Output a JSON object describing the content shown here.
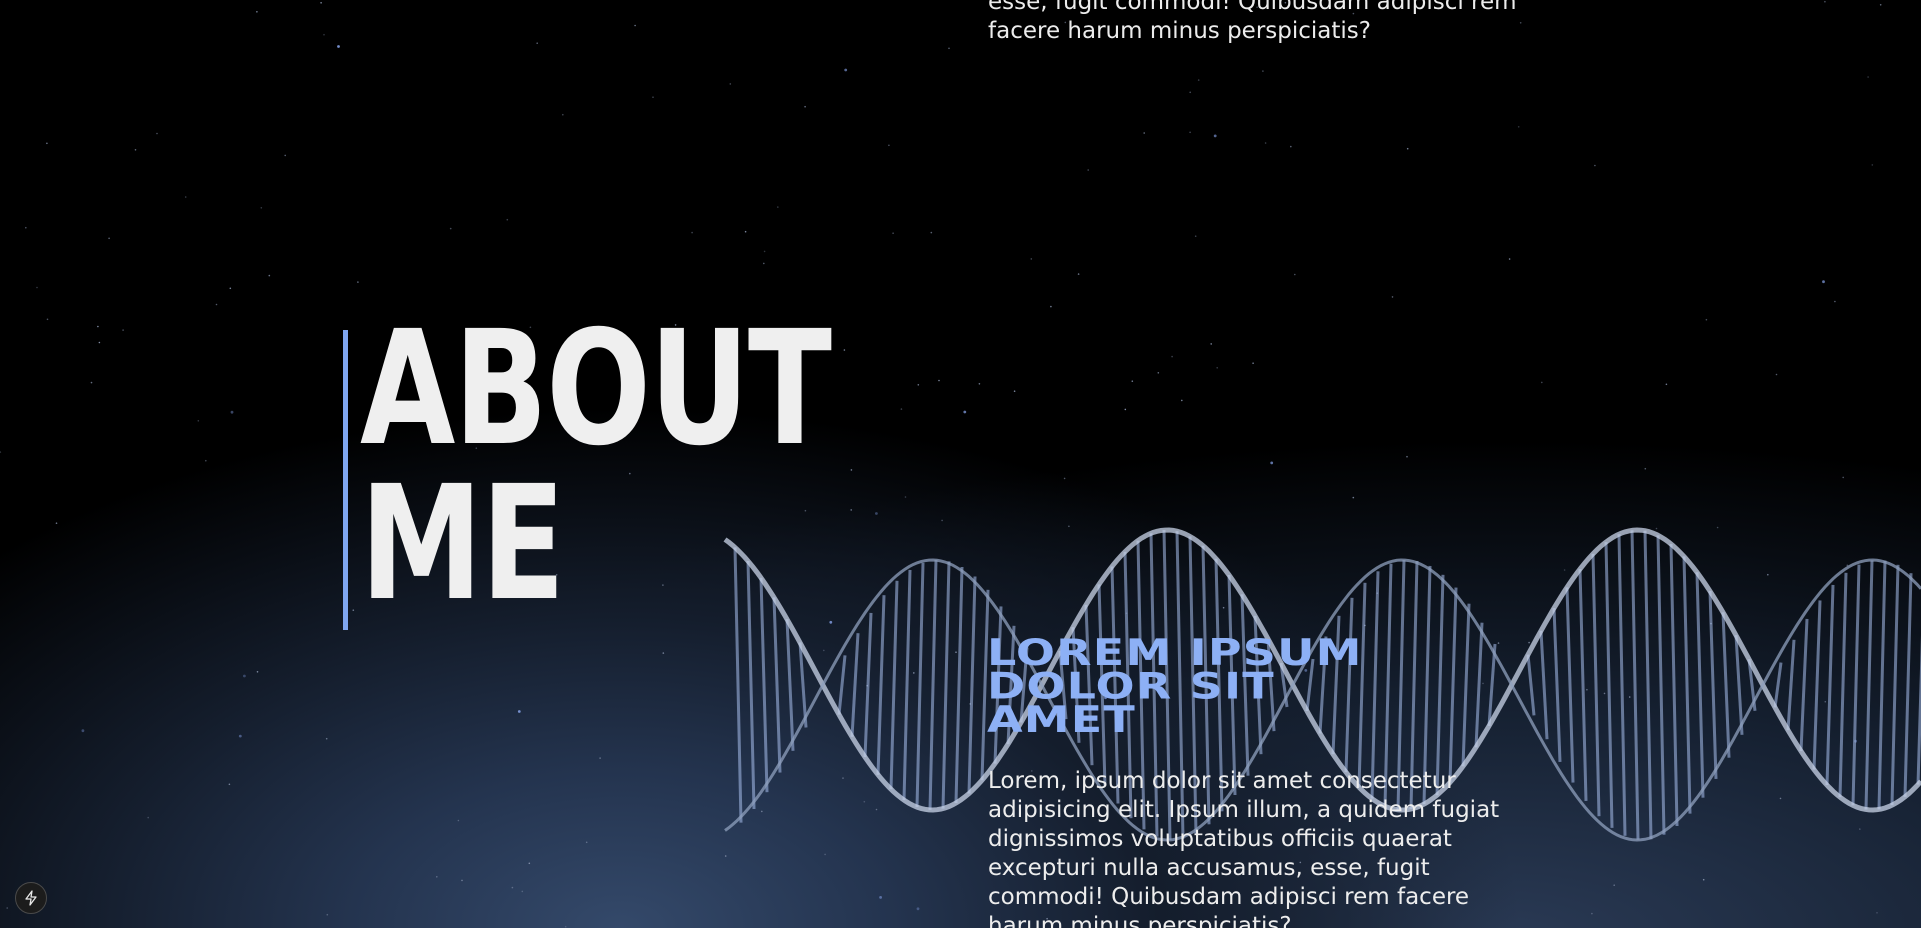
{
  "intro": {
    "text": "esse, fugit commodi! Quibusdam adipisci rem facere harum minus perspiciatis?"
  },
  "about": {
    "title_line1": "ABOUT",
    "title_line2": "ME",
    "accent_color": "#7fa6f0"
  },
  "section": {
    "heading_line1": "LOREM IPSUM",
    "heading_line2": "DOLOR SIT",
    "heading_line3": "AMET",
    "heading_color": "#8db0f5",
    "body": "Lorem, ipsum dolor sit amet consectetur adipisicing elit. Ipsum illum, a quidem fugiat dignissimos voluptatibus officiis quaerat excepturi nulla accusamus, esse, fugit commodi! Quibusdam adipisci rem facere harum minus perspiciatis?"
  },
  "dev_button": {
    "icon": "bolt-icon"
  },
  "background": {
    "colors": [
      "#000000",
      "#34496a"
    ]
  }
}
